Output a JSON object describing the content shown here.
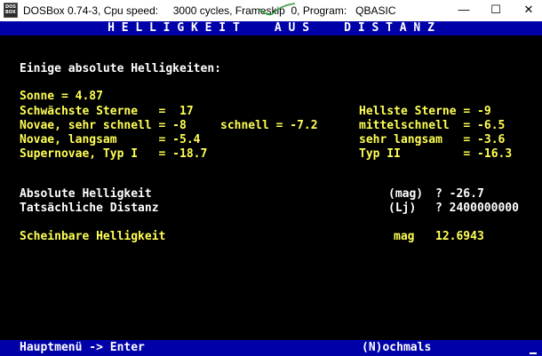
{
  "window": {
    "title": "DOSBox 0.74-3, Cpu speed:     3000 cycles, Frameskip  0, Program:   QBASIC",
    "icon_lines": [
      "DOS",
      "BOX"
    ],
    "controls": {
      "minimize": "—",
      "maximize": "☐",
      "close": "✕"
    }
  },
  "screen": {
    "heading": "H E L L I G K E I T     A U S     D I S T A N Z",
    "intro": "Einige absolute Helligkeiten:",
    "sun": "Sonne = 4.87",
    "left_table": [
      "Schwächste Sterne   =  17",
      "Novae, sehr schnell = -8",
      "Novae, langsam      = -5.4",
      "Supernovae, Typ I   = -18.7"
    ],
    "mid_entry": "schnell = -7.2",
    "right_table": [
      "Hellste Sterne = -9",
      "mittelschnell  = -6.5",
      "sehr langsam   = -3.6",
      "Typ II         = -16.3"
    ],
    "abs_label": "Absolute Helligkeit",
    "abs_unit": "(mag)",
    "abs_value": "? -26.7",
    "dist_label": "Tatsächliche Distanz",
    "dist_unit": "(Lj)",
    "dist_value": "? 2400000000",
    "result_label": "Scheinbare Helligkeit",
    "result_unit": "mag",
    "result_value": "12.6943",
    "footer_left": "Hauptmenü -> Enter",
    "footer_right": "(N)ochmals"
  },
  "colors": {
    "dos_blue": "#0000a8",
    "dos_yellow": "#ffff55",
    "dos_white": "#ffffff",
    "background": "#000000"
  }
}
